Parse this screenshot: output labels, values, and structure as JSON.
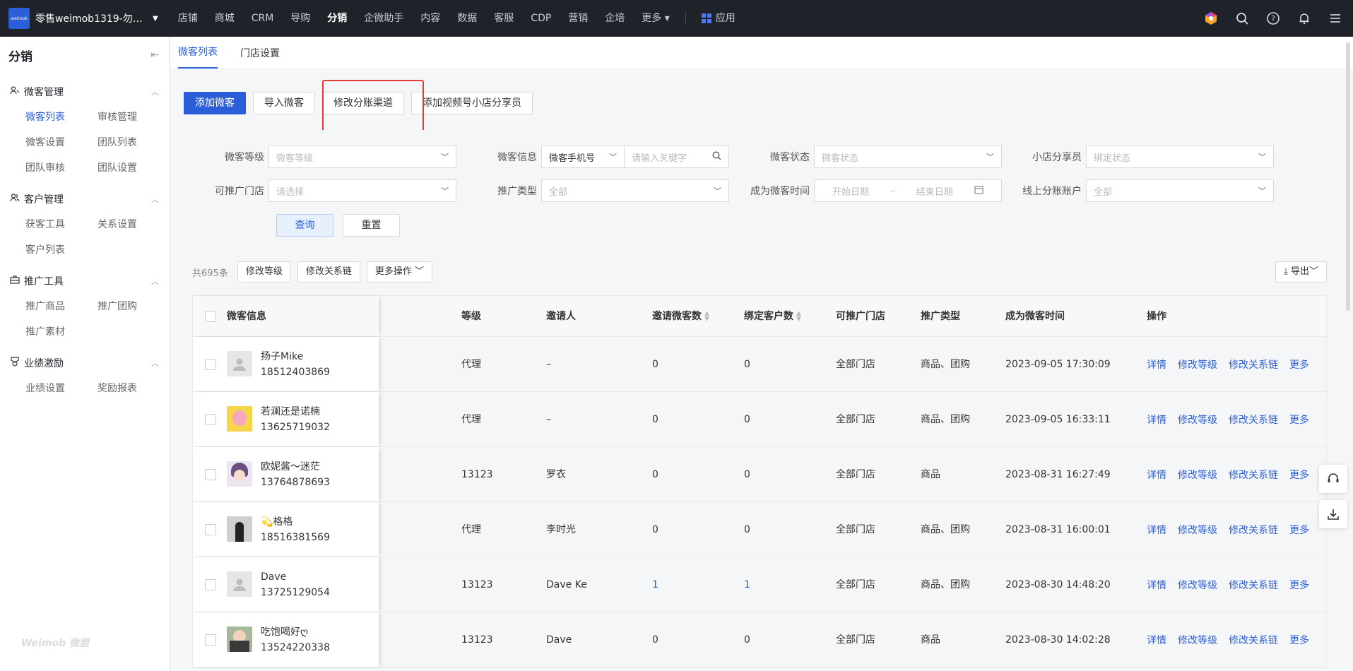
{
  "topbar": {
    "logo_text": "weimob",
    "store_name": "零售weimob1319-勿用...",
    "nav": [
      "店铺",
      "商城",
      "CRM",
      "导购",
      "分销",
      "企微助手",
      "内容",
      "数据",
      "客服",
      "CDP",
      "营销",
      "企培",
      "更多"
    ],
    "active_nav": "分销",
    "app_label": "应用"
  },
  "sidebar": {
    "title": "分销",
    "groups": [
      {
        "title": "微客管理",
        "icon": "user-group-icon",
        "items": [
          "微客列表",
          "审核管理",
          "微客设置",
          "团队列表",
          "团队审核",
          "团队设置"
        ]
      },
      {
        "title": "客户管理",
        "icon": "users-icon",
        "items": [
          "获客工具",
          "关系设置",
          "客户列表"
        ]
      },
      {
        "title": "推广工具",
        "icon": "toolbox-icon",
        "items": [
          "推广商品",
          "推广团购",
          "推广素材"
        ]
      },
      {
        "title": "业绩激励",
        "icon": "medal-icon",
        "items": [
          "业绩设置",
          "奖励报表"
        ]
      }
    ],
    "active_item": "微客列表",
    "footer": "Weimob 微盟"
  },
  "tabs": [
    "微客列表",
    "门店设置"
  ],
  "actions": {
    "add": "添加微客",
    "import": "导入微客",
    "modify_channel": "修改分账渠道",
    "add_video": "添加视频号小店分享员"
  },
  "filters": {
    "level_label": "微客等级",
    "level_placeholder": "微客等级",
    "info_label": "微客信息",
    "info_type": "微客手机号",
    "info_placeholder": "请输入关键字",
    "status_label": "微客状态",
    "status_placeholder": "微客状态",
    "sharer_label": "小店分享员",
    "sharer_placeholder": "绑定状态",
    "store_label": "可推广门店",
    "store_placeholder": "请选择",
    "promo_label": "推广类型",
    "promo_value": "全部",
    "time_label": "成为微客时间",
    "start_date": "开始日期",
    "date_sep": "–",
    "end_date": "结束日期",
    "account_label": "线上分账账户",
    "account_value": "全部",
    "query": "查询",
    "reset": "重置"
  },
  "toolbar": {
    "total": "共695条",
    "modify_level": "修改等级",
    "modify_relation": "修改关系链",
    "more_ops": "更多操作",
    "export": "导出"
  },
  "table": {
    "headers": {
      "info": "微客信息",
      "level": "等级",
      "inviter": "邀请人",
      "invite_count": "邀请微客数",
      "bind_count": "绑定客户数",
      "stores": "可推广门店",
      "promo": "推广类型",
      "time": "成为微客时间",
      "ops": "操作"
    },
    "op_labels": [
      "详情",
      "修改等级",
      "修改关系链",
      "更多"
    ],
    "rows": [
      {
        "name": "扬子Mike",
        "phone": "18512403869",
        "level": "代理",
        "inviter": "–",
        "invite": "0",
        "bind": "0",
        "stores": "全部门店",
        "promo": "商品、团购",
        "time": "2023-09-05 17:30:09",
        "avatar": "default"
      },
      {
        "name": "若澜还是诺楠",
        "phone": "13625719032",
        "level": "代理",
        "inviter": "–",
        "invite": "0",
        "bind": "0",
        "stores": "全部门店",
        "promo": "商品、团购",
        "time": "2023-09-05 16:33:11",
        "avatar": "yellow"
      },
      {
        "name": "欧妮酱～迷茫",
        "phone": "13764878693",
        "level": "13123",
        "inviter": "罗衣",
        "invite": "0",
        "bind": "0",
        "stores": "全部门店",
        "promo": "商品",
        "time": "2023-08-31 16:27:49",
        "avatar": "purple"
      },
      {
        "name": "💫格格",
        "phone": "18516381569",
        "level": "代理",
        "inviter": "李时光",
        "invite": "0",
        "bind": "0",
        "stores": "全部门店",
        "promo": "商品、团购",
        "time": "2023-08-31 16:00:01",
        "avatar": "dark"
      },
      {
        "name": "Dave",
        "phone": "13725129054",
        "level": "13123",
        "inviter": "Dave Ke",
        "invite": "1",
        "bind": "1",
        "stores": "全部门店",
        "promo": "商品、团购",
        "time": "2023-08-30 14:48:20",
        "avatar": "default"
      },
      {
        "name": "吃饱喝好ღ",
        "phone": "13524220338",
        "level": "13123",
        "inviter": "Dave",
        "invite": "0",
        "bind": "0",
        "stores": "全部门店",
        "promo": "商品",
        "time": "2023-08-30 14:02:28",
        "avatar": "photo"
      }
    ]
  },
  "colors": {
    "accent": "#2b5fd9",
    "topbar": "#1f2329",
    "highlight": "#e53935"
  }
}
